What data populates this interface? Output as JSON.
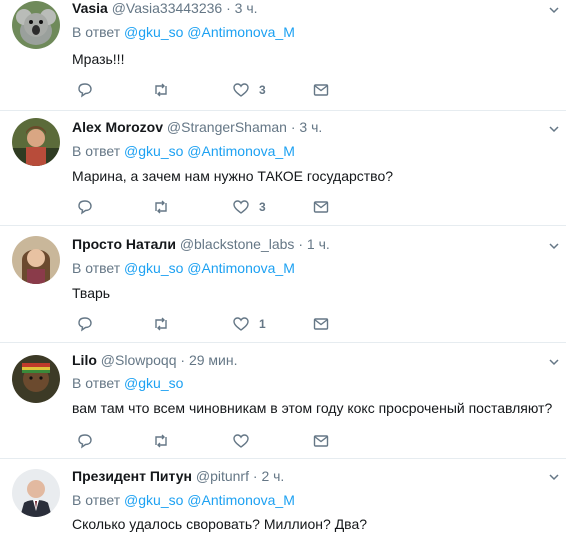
{
  "reply_prefix": "В ответ",
  "tweets": [
    {
      "name": "Vasia",
      "handle": "@Vasia33443236",
      "time": "3 ч.",
      "mentions": [
        "@gku_so",
        "@Antimonova_M"
      ],
      "text": "Мразь!!!",
      "likes": "3"
    },
    {
      "name": "Alex Morozov",
      "handle": "@StrangerShaman",
      "time": "3 ч.",
      "mentions": [
        "@gku_so",
        "@Antimonova_M"
      ],
      "text": "Марина, а зачем нам нужно ТАКОЕ государство?",
      "likes": "3"
    },
    {
      "name": "Просто Натали",
      "handle": "@blackstone_labs",
      "time": "1 ч.",
      "mentions": [
        "@gku_so",
        "@Antimonova_M"
      ],
      "text": "Тварь",
      "likes": "1"
    },
    {
      "name": "Lilo",
      "handle": "@Slowpoqq",
      "time": "29 мин.",
      "mentions": [
        "@gku_so"
      ],
      "text": "вам там что всем чиновникам в этом году кокс просроченый поставляют?",
      "likes": ""
    },
    {
      "name": "Президент Питун",
      "handle": "@pitunrf",
      "time": "2 ч.",
      "mentions": [
        "@gku_so",
        "@Antimonova_M"
      ],
      "text": "Сколько удалось своровать? Миллион? Два?",
      "likes": ""
    }
  ],
  "colors": {
    "link": "#1da1f2",
    "secondary": "#657786",
    "divider": "#e6ecf0"
  },
  "icons": [
    "reply-icon",
    "retweet-icon",
    "like-icon",
    "direct-message-icon",
    "chevron-down-icon"
  ]
}
